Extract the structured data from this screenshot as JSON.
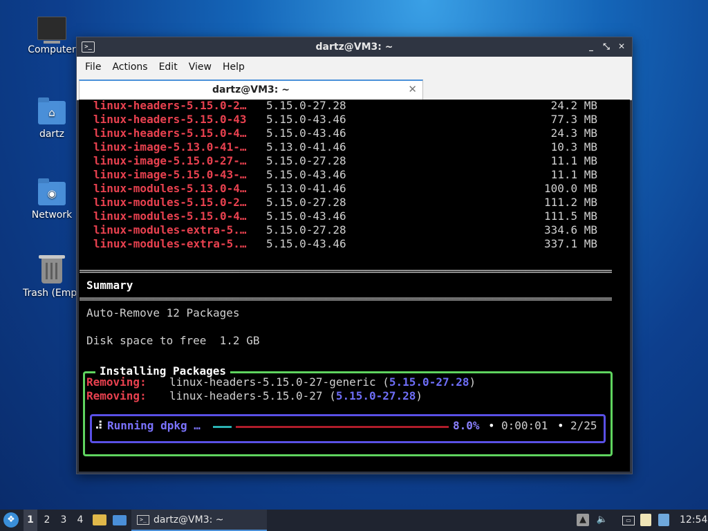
{
  "desktop": {
    "icons": [
      {
        "label": "Computer"
      },
      {
        "label": "dartz"
      },
      {
        "label": "Network"
      },
      {
        "label": "Trash (Empty)"
      }
    ]
  },
  "window": {
    "title": "dartz@VM3: ~",
    "controls": {
      "minimize": "_",
      "maximize": "⤡",
      "close": "✕"
    },
    "menu": [
      "File",
      "Actions",
      "Edit",
      "View",
      "Help"
    ],
    "tab": {
      "label": "dartz@VM3: ~",
      "close": "✕"
    }
  },
  "terminal": {
    "packages": [
      {
        "name": "linux-headers-5.15.0-2…",
        "version": "5.15.0-27.28",
        "size": "24.2 MB"
      },
      {
        "name": "linux-headers-5.15.0-43",
        "version": "5.15.0-43.46",
        "size": "77.3 MB"
      },
      {
        "name": "linux-headers-5.15.0-4…",
        "version": "5.15.0-43.46",
        "size": "24.3 MB"
      },
      {
        "name": "linux-image-5.13.0-41-…",
        "version": "5.13.0-41.46",
        "size": "10.3 MB"
      },
      {
        "name": "linux-image-5.15.0-27-…",
        "version": "5.15.0-27.28",
        "size": "11.1 MB"
      },
      {
        "name": "linux-image-5.15.0-43-…",
        "version": "5.15.0-43.46",
        "size": "11.1 MB"
      },
      {
        "name": "linux-modules-5.13.0-4…",
        "version": "5.13.0-41.46",
        "size": "100.0 MB"
      },
      {
        "name": "linux-modules-5.15.0-2…",
        "version": "5.15.0-27.28",
        "size": "111.2 MB"
      },
      {
        "name": "linux-modules-5.15.0-4…",
        "version": "5.15.0-43.46",
        "size": "111.5 MB"
      },
      {
        "name": "linux-modules-extra-5.…",
        "version": "5.15.0-27.28",
        "size": "334.6 MB"
      },
      {
        "name": "linux-modules-extra-5.…",
        "version": "5.15.0-43.46",
        "size": "337.1 MB"
      }
    ],
    "rule": "════════════════════════════════════════════════════════════════════════════════════════════════════════",
    "summary_heading": "Summary",
    "auto_remove": "Auto-Remove 12 Packages",
    "disk_space": "Disk space to free  1.2 GB",
    "installing_title": "Installing Packages",
    "removing_label": "Removing:",
    "removals": [
      {
        "package": "linux-headers-5.15.0-27-generic",
        "version": "5.15.0-27.28"
      },
      {
        "package": "linux-headers-5.15.0-27",
        "version": "5.15.0-27.28"
      }
    ],
    "progress": {
      "spinner": "⠼",
      "label": "Running dpkg …",
      "percent_text": "8.0%",
      "fraction": 0.08,
      "elapsed": "0:00:01",
      "count": "2/25",
      "bullet": "•"
    }
  },
  "taskbar": {
    "workspaces": [
      "1",
      "2",
      "3",
      "4"
    ],
    "active_workspace": "1",
    "task_label": "dartz@VM3: ~",
    "clock": "12:54"
  }
}
